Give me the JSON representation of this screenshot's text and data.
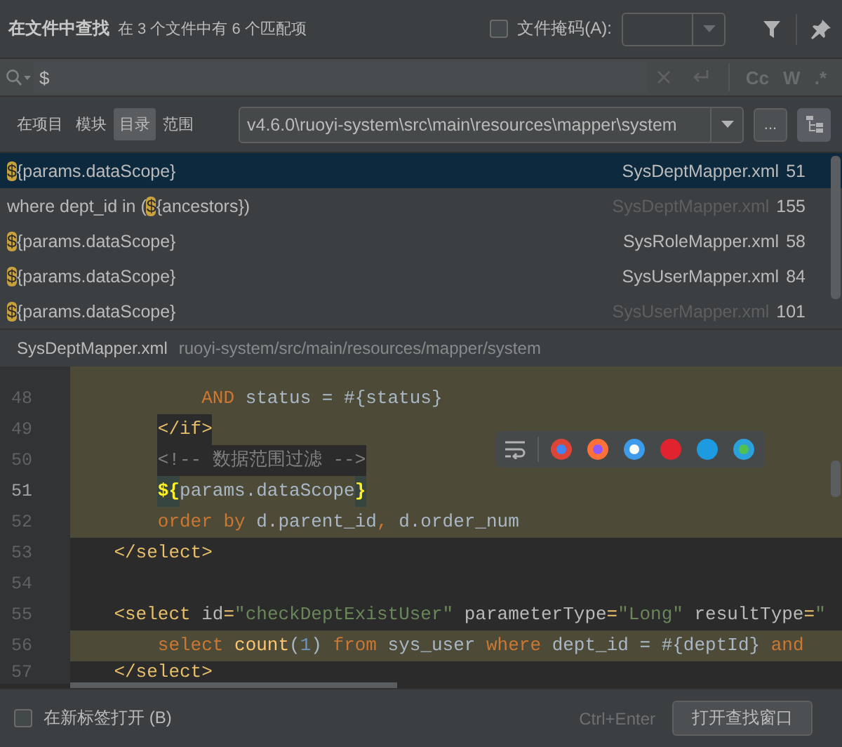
{
  "header": {
    "title": "在文件中查找",
    "summary": "在 3 个文件中有 6 个匹配项",
    "file_mask": {
      "label": "文件掩码(A):",
      "checked": false
    }
  },
  "search": {
    "value": "$"
  },
  "search_options": [
    {
      "label": "Cc",
      "selected": false
    },
    {
      "label": "W",
      "selected": false
    },
    {
      "label": ".*",
      "selected": false
    }
  ],
  "scopes": [
    {
      "label": "在项目",
      "selected": false
    },
    {
      "label": "模块",
      "selected": false
    },
    {
      "label": "目录",
      "selected": true
    },
    {
      "label": "范围",
      "selected": false
    }
  ],
  "directory": {
    "value": "v4.6.0\\ruoyi-system\\src\\main\\resources\\mapper\\system",
    "more": "...",
    "tree_view": true
  },
  "results": [
    {
      "match": "$",
      "after": "{params.dataScope}",
      "file": "SysDeptMapper.xml",
      "line": "51",
      "selected": true,
      "dimmed": false
    },
    {
      "before": "where dept_id in (",
      "match": "$",
      "after": "{ancestors})",
      "file": "SysDeptMapper.xml",
      "line": "155",
      "selected": false,
      "dimmed": true
    },
    {
      "match": "$",
      "after": "{params.dataScope}",
      "file": "SysRoleMapper.xml",
      "line": "58",
      "selected": false,
      "dimmed": false
    },
    {
      "match": "$",
      "after": "{params.dataScope}",
      "file": "SysUserMapper.xml",
      "line": "84",
      "selected": false,
      "dimmed": false
    },
    {
      "match": "$",
      "after": "{params.dataScope}",
      "file": "SysUserMapper.xml",
      "line": "101",
      "selected": false,
      "dimmed": true
    }
  ],
  "preview": {
    "file": "SysDeptMapper.xml",
    "path": "ruoyi-system/src/main/resources/mapper/system"
  },
  "editor": {
    "lines": [
      {
        "number": "48",
        "kind": "deep",
        "current": false,
        "highlighted": true,
        "tokens": [
          {
            "kind": "keyword",
            "text": "AND"
          },
          {
            "kind": "plain",
            "text": " status = #{status}"
          }
        ]
      },
      {
        "number": "49",
        "kind": "inner",
        "current": false,
        "highlighted": true,
        "tokens": [
          {
            "kind": "tag",
            "text": "</if>",
            "boxed": true
          }
        ]
      },
      {
        "number": "50",
        "kind": "inner",
        "current": false,
        "highlighted": true,
        "tokens": [
          {
            "kind": "comment",
            "text": "<!-- 数据范围过滤 -->",
            "boxed": true
          }
        ]
      },
      {
        "number": "51",
        "kind": "inner",
        "current": true,
        "highlighted": true,
        "tokens": [
          {
            "kind": "brace",
            "text": "${",
            "boxed": true
          },
          {
            "kind": "plain",
            "text": "params.dataScope"
          },
          {
            "kind": "brace",
            "text": "}",
            "boxed": true
          }
        ]
      },
      {
        "number": "52",
        "kind": "inner",
        "current": false,
        "highlighted": true,
        "tokens": [
          {
            "kind": "keyword",
            "text": "order by"
          },
          {
            "kind": "plain",
            "text": " d.parent_id"
          },
          {
            "kind": "keyword",
            "text": ","
          },
          {
            "kind": "plain",
            "text": " d.order_num"
          }
        ]
      },
      {
        "number": "53",
        "kind": "outer",
        "current": false,
        "highlighted": false,
        "tokens": [
          {
            "kind": "tag",
            "text": "</select>"
          }
        ]
      },
      {
        "number": "54",
        "kind": "outer",
        "current": false,
        "highlighted": false
      },
      {
        "number": "55",
        "kind": "outer",
        "current": false,
        "highlighted": false,
        "tokens": [
          {
            "kind": "tag",
            "text": "<select "
          },
          {
            "kind": "attr",
            "text": "id"
          },
          {
            "kind": "tag",
            "text": "="
          },
          {
            "kind": "string",
            "text": "\"checkDeptExistUser\""
          },
          {
            "kind": "attr",
            "text": " parameterType"
          },
          {
            "kind": "tag",
            "text": "="
          },
          {
            "kind": "string",
            "text": "\"Long\""
          },
          {
            "kind": "attr",
            "text": " resultType"
          },
          {
            "kind": "tag",
            "text": "="
          },
          {
            "kind": "string",
            "text": "\""
          }
        ]
      },
      {
        "number": "56",
        "kind": "inner",
        "current": false,
        "highlighted": true,
        "tokens": [
          {
            "kind": "keyword",
            "text": "select"
          },
          {
            "kind": "function",
            "text": " count"
          },
          {
            "kind": "plain",
            "text": "("
          },
          {
            "kind": "number",
            "text": "1"
          },
          {
            "kind": "plain",
            "text": ") "
          },
          {
            "kind": "keyword",
            "text": "from"
          },
          {
            "kind": "plain",
            "text": " sys_user "
          },
          {
            "kind": "keyword",
            "text": "where"
          },
          {
            "kind": "plain",
            "text": " dept_id = #{deptId} "
          },
          {
            "kind": "keyword",
            "text": "and"
          }
        ]
      },
      {
        "number": "57",
        "kind": "outer",
        "current": false,
        "highlighted": false,
        "tokens": [
          {
            "kind": "tag",
            "text": "</select>"
          }
        ]
      }
    ]
  },
  "footer": {
    "new_tab": {
      "label": "在新标签打开 (B)",
      "checked": false
    },
    "shortcut": "Ctrl+Enter",
    "button": "打开查找窗口"
  }
}
